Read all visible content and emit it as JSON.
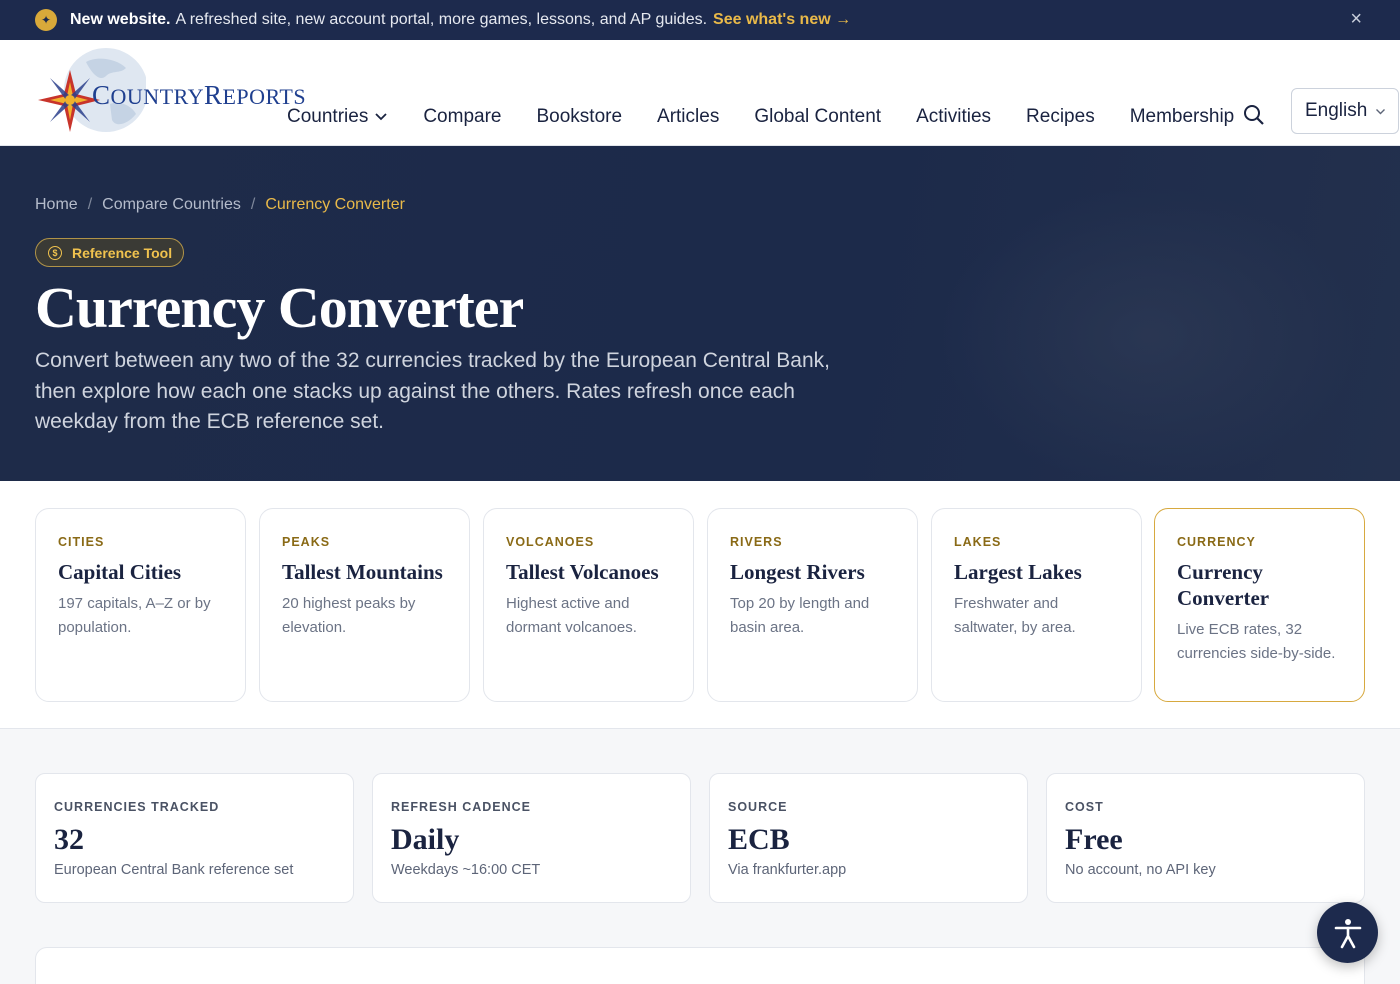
{
  "announcement": {
    "bold": "New website.",
    "message": "A refreshed site, new account portal, more games, lessons, and AP guides.",
    "link": "See what's new →",
    "close": "×"
  },
  "logo": {
    "first": "C",
    "rest1": "OUNTRY",
    "second": "R",
    "rest2": "EPORTS"
  },
  "nav": {
    "items": [
      "Countries",
      "Compare",
      "Bookstore",
      "Articles",
      "Global Content",
      "Activities",
      "Recipes",
      "Membership"
    ],
    "language": "English"
  },
  "breadcrumb": [
    "Home",
    "Compare Countries",
    "Currency Converter"
  ],
  "hero": {
    "badge": "Reference Tool",
    "title": "Currency Converter",
    "description": "Convert between any two of the 32 currencies tracked by the European Central Bank, then explore how each one stacks up against the others. Rates refresh once each weekday from the ECB reference set."
  },
  "tools": [
    {
      "tag": "CITIES",
      "title": "Capital Cities",
      "sub": "197 capitals, A–Z or by population."
    },
    {
      "tag": "PEAKS",
      "title": "Tallest Mountains",
      "sub": "20 highest peaks by elevation."
    },
    {
      "tag": "VOLCANOES",
      "title": "Tallest Volcanoes",
      "sub": "Highest active and dormant volcanoes."
    },
    {
      "tag": "RIVERS",
      "title": "Longest Rivers",
      "sub": "Top 20 by length and basin area."
    },
    {
      "tag": "LAKES",
      "title": "Largest Lakes",
      "sub": "Freshwater and saltwater, by area."
    },
    {
      "tag": "CURRENCY",
      "title": "Currency Converter",
      "sub": "Live ECB rates, 32 currencies side-by-side."
    }
  ],
  "stats": [
    {
      "label": "CURRENCIES TRACKED",
      "value": "32",
      "note": "European Central Bank reference set"
    },
    {
      "label": "REFRESH CADENCE",
      "value": "Daily",
      "note": "Weekdays ~16:00 CET"
    },
    {
      "label": "SOURCE",
      "value": "ECB",
      "note": "Via frankfurter.app"
    },
    {
      "label": "COST",
      "value": "Free",
      "note": "No account, no API key"
    }
  ],
  "colors": {
    "navy": "#1d2a4d",
    "gold": "#e9b949",
    "accent_border": "#d7a93f"
  }
}
